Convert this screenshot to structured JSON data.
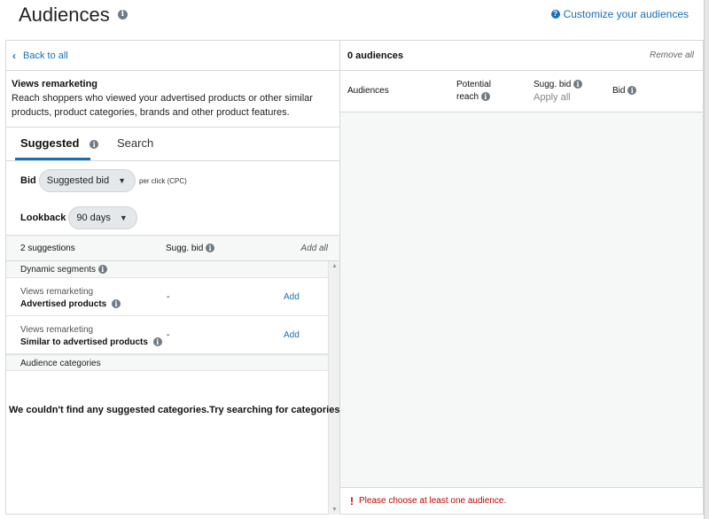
{
  "header": {
    "title": "Audiences",
    "customize_link": "Customize your audiences"
  },
  "left": {
    "back": "Back to all",
    "desc_title": "Views remarketing",
    "desc_text": "Reach shoppers who viewed your advertised products or other similar products, product categories, brands and other product features.",
    "tabs": {
      "suggested": "Suggested",
      "search": "Search"
    },
    "bid_label": "Bid",
    "bid_value": "Suggested bid",
    "per_click": "per click (CPC)",
    "lookback_label": "Lookback",
    "lookback_value": "90 days",
    "suggestions_count": "2 suggestions",
    "sugg_bid": "Sugg. bid",
    "add_all": "Add all",
    "section_dynamic": "Dynamic segments",
    "items": [
      {
        "category": "Views remarketing",
        "segment": "Advertised products",
        "bid": "-",
        "action": "Add"
      },
      {
        "category": "Views remarketing",
        "segment": "Similar to advertised products",
        "bid": "-",
        "action": "Add"
      }
    ],
    "section_categories": "Audience categories",
    "empty_message": "We couldn't find any suggested categories.Try searching for categories."
  },
  "right": {
    "count": "0 audiences",
    "remove_all": "Remove all",
    "col_audiences": "Audiences",
    "col_reach_line1": "Potential",
    "col_reach_line2": "reach",
    "col_sugg_bid": "Sugg. bid",
    "apply_all": "Apply all",
    "col_bid": "Bid",
    "error": "Please choose at least one audience."
  },
  "colors": {
    "link": "#1a6fb5",
    "error": "#c40000",
    "border": "#d5d9d9"
  }
}
